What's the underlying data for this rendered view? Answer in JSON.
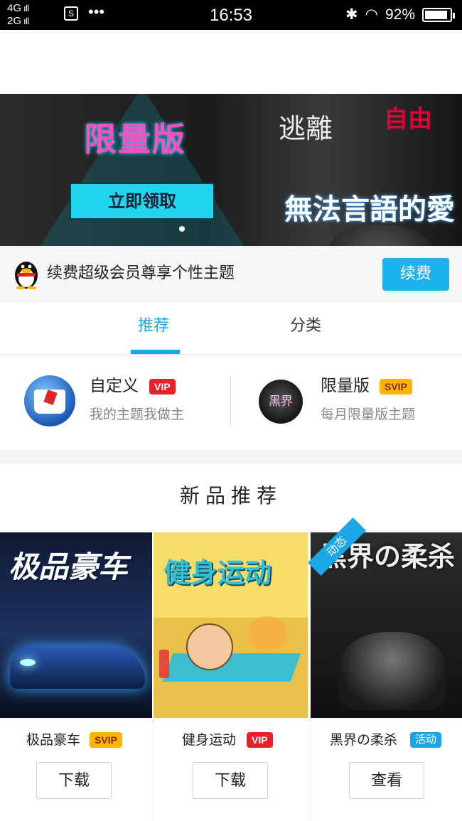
{
  "status_bar": {
    "net_top": "4G",
    "net_bottom": "2G",
    "bars": "ıIl",
    "screenshot_glyph": "S",
    "dots": "•••",
    "time": "16:53",
    "bluetooth_icon": "✱",
    "wifi_icon": "◠",
    "battery_percent": "92%",
    "battery_level": 0.92
  },
  "banner": {
    "headline": "限量版",
    "cta_label": "立即领取",
    "right_text_a": "逃離",
    "right_text_b": "自由",
    "right_text_c": "無法言語的愛",
    "active_slide": 1
  },
  "renew": {
    "text": "续费超级会员尊享个性主题",
    "button_label": "续费"
  },
  "tabs": [
    {
      "label": "推荐",
      "active": true
    },
    {
      "label": "分类",
      "active": false
    }
  ],
  "features": [
    {
      "title": "自定义",
      "badge": "VIP",
      "subtitle": "我的主题我做主"
    },
    {
      "title": "限量版",
      "badge": "SVIP",
      "subtitle": "每月限量版主题",
      "icon_text": "黑界"
    }
  ],
  "section_title": "新品推荐",
  "cards": [
    {
      "name": "极品豪车",
      "badge": "SVIP",
      "image_text": "极品豪车",
      "button_label": "下载"
    },
    {
      "name": "健身运动",
      "badge": "VIP",
      "image_text": "健身运动",
      "button_label": "下载"
    },
    {
      "name": "黑界の柔杀",
      "badge": "活动",
      "image_text": "黑界の柔杀",
      "ribbon": "动态",
      "button_label": "查看"
    }
  ],
  "colors": {
    "accent": "#1aa7e8",
    "vip_red": "#e8202a",
    "svip_gold": "#ffb400"
  }
}
